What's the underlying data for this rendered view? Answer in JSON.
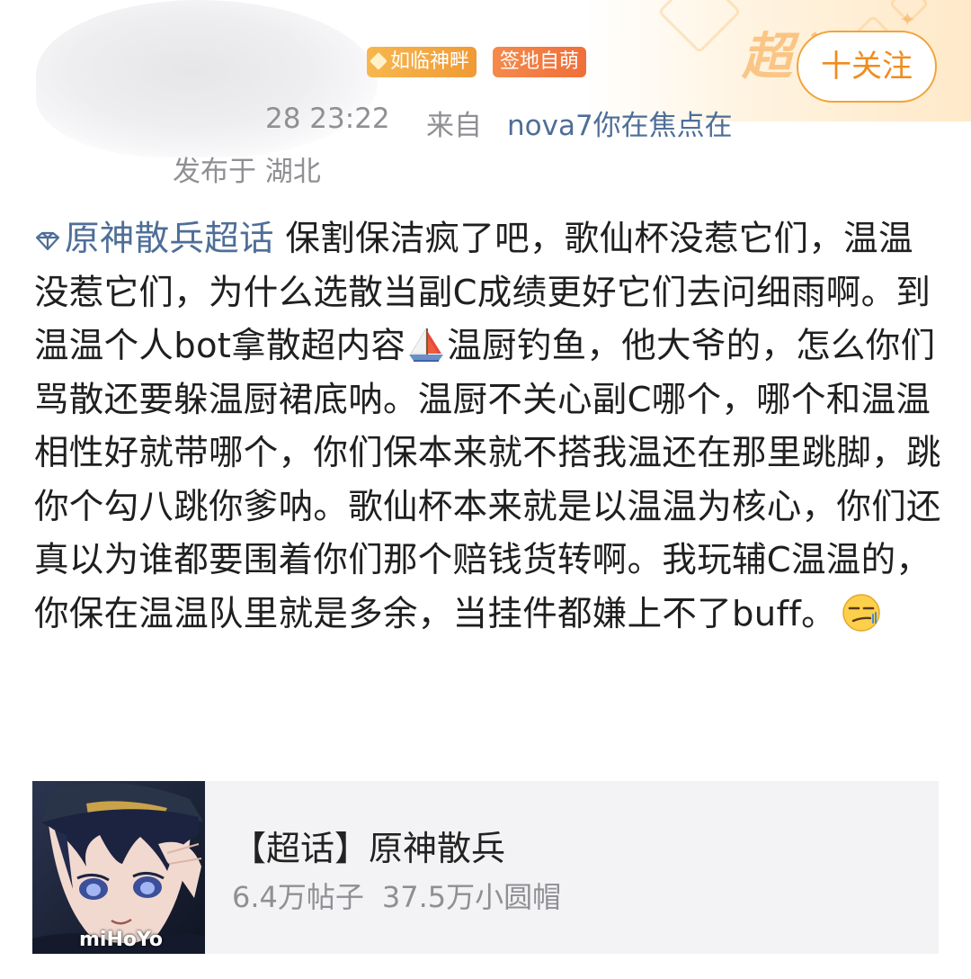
{
  "header": {
    "badges": [
      "如临神畔",
      "签地自萌"
    ],
    "follow_label": "十关注",
    "super_word": "超话"
  },
  "meta": {
    "time": "28  23:22",
    "from_label": "来自",
    "device": "nova7你在焦点在",
    "location": "发布于  湖北"
  },
  "post": {
    "topic": "原神散兵超话",
    "text_part1": " 保割保洁疯了吧，歌仙杯没惹它们，温温没惹它们，为什么选散当副C成绩更好它们去问细雨啊。到温温个人bot拿散超内容",
    "text_part2": "温厨钓鱼，他大爷的，怎么你们骂散还要躲温厨裙底呐。温厨不关心副C哪个，哪个和温温相性好就带哪个，你们保本来就不搭我温还在那里跳脚，跳你个勾八跳你爹呐。歌仙杯本来就是以温温为核心，你们还真以为谁都要围着你们那个赔钱货转啊。我玩辅C温温的，你保在温温队里就是多余，当挂件都嫌上不了buff。",
    "emojis": [
      "sailboat-emoji",
      "smirk-face-emoji"
    ]
  },
  "card": {
    "title": "【超话】原神散兵",
    "posts": "6.4万帖子",
    "members": "37.5万小圆帽",
    "thumb_logo": "miHoYo"
  },
  "colors": {
    "link": "#4e6e98",
    "accent": "#f2a33a",
    "meta": "#8f8f94",
    "card_bg": "#f3f3f5"
  }
}
